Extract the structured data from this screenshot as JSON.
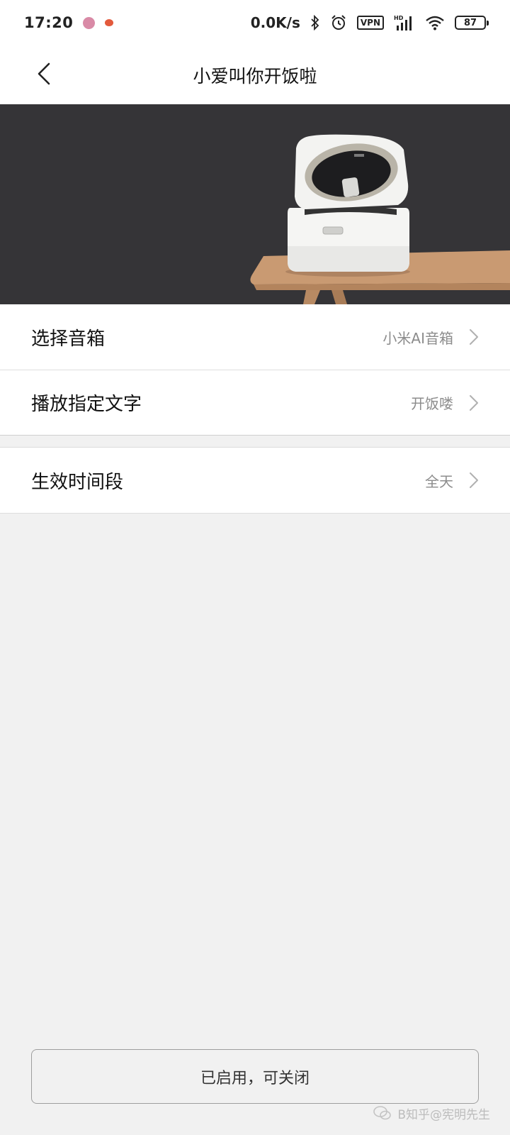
{
  "status_bar": {
    "time": "17:20",
    "network_speed": "0.0K/s",
    "vpn_label": "VPN",
    "signal_label": "HD",
    "battery_level": "87",
    "icons": [
      "app-notification-icon",
      "tomato-app-icon",
      "bluetooth-icon",
      "alarm-icon",
      "vpn-icon",
      "signal-icon",
      "wifi-icon",
      "battery-icon"
    ]
  },
  "header": {
    "back_icon": "chevron-left-icon",
    "title": "小爱叫你开饭啦"
  },
  "banner": {
    "image": "rice-cooker-on-table",
    "background_color": "#353437"
  },
  "settings": {
    "group_1": [
      {
        "label": "选择音箱",
        "value": "小米AI音箱"
      },
      {
        "label": "播放指定文字",
        "value": "开饭喽"
      }
    ],
    "group_2": [
      {
        "label": "生效时间段",
        "value": "全天"
      }
    ]
  },
  "action_button": {
    "label": "已启用，可关闭"
  },
  "watermark": {
    "text": "B知乎@宪明先生"
  }
}
